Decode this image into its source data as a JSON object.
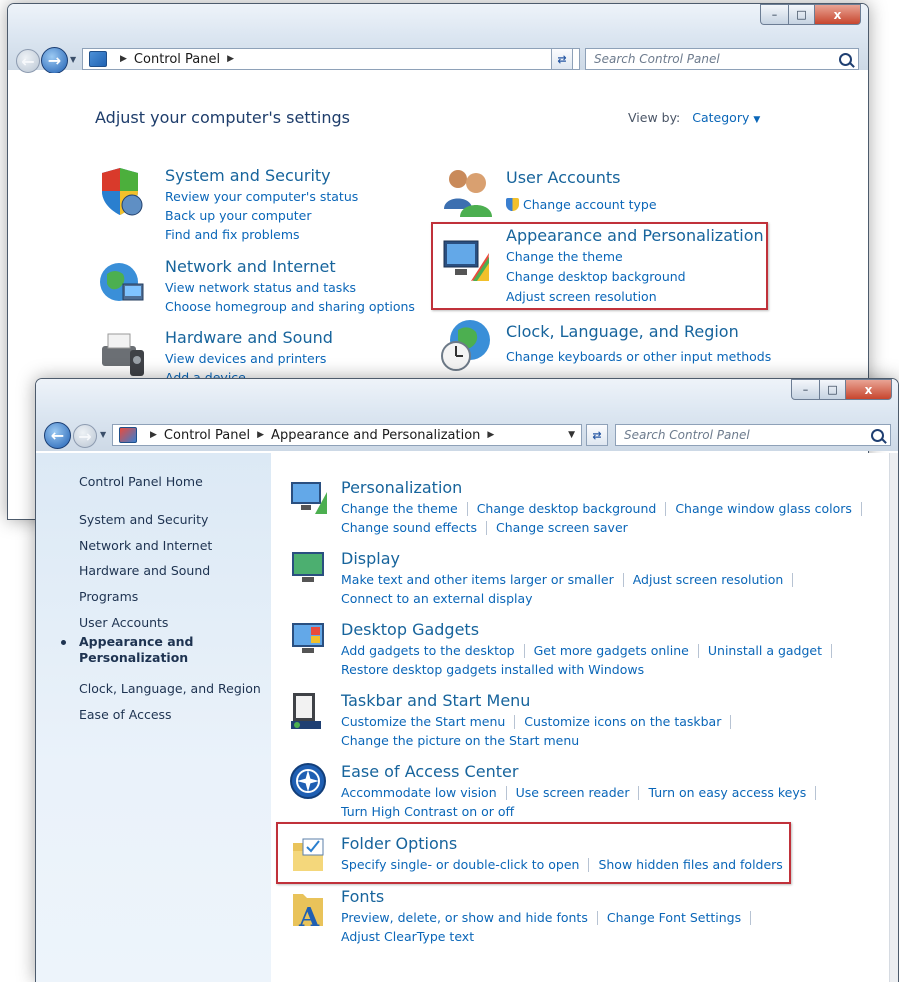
{
  "back_window": {
    "breadcrumb": [
      "Control Panel"
    ],
    "search_placeholder": "Search Control Panel",
    "heading": "Adjust your computer's settings",
    "view_by_label": "View by:",
    "view_by_value": "Category",
    "categories": [
      {
        "title": "System and Security",
        "links": [
          "Review your computer's status",
          "Back up your computer",
          "Find and fix problems"
        ]
      },
      {
        "title": "Network and Internet",
        "links": [
          "View network status and tasks",
          "Choose homegroup and sharing options"
        ]
      },
      {
        "title": "Hardware and Sound",
        "links": [
          "View devices and printers",
          "Add a device"
        ]
      },
      {
        "title": "User Accounts",
        "links": [
          "Change account type"
        ]
      },
      {
        "title": "Appearance and Personalization",
        "links": [
          "Change the theme",
          "Change desktop background",
          "Adjust screen resolution"
        ]
      },
      {
        "title": "Clock, Language, and Region",
        "links": [
          "Change keyboards or other input methods"
        ]
      }
    ]
  },
  "front_window": {
    "breadcrumb": [
      "Control Panel",
      "Appearance and Personalization"
    ],
    "search_placeholder": "Search Control Panel",
    "sidebar": {
      "home": "Control Panel Home",
      "items": [
        {
          "label": "System and Security"
        },
        {
          "label": "Network and Internet"
        },
        {
          "label": "Hardware and Sound"
        },
        {
          "label": "Programs"
        },
        {
          "label": "User Accounts"
        },
        {
          "label": "Appearance and Personalization",
          "active": true
        },
        {
          "label": "Clock, Language, and Region"
        },
        {
          "label": "Ease of Access"
        }
      ]
    },
    "tasks": [
      {
        "title": "Personalization",
        "rows": [
          [
            "Change the theme",
            "Change desktop background",
            "Change window glass colors"
          ],
          [
            "Change sound effects",
            "Change screen saver"
          ]
        ]
      },
      {
        "title": "Display",
        "rows": [
          [
            "Make text and other items larger or smaller",
            "Adjust screen resolution"
          ],
          [
            "Connect to an external display"
          ]
        ]
      },
      {
        "title": "Desktop Gadgets",
        "rows": [
          [
            "Add gadgets to the desktop",
            "Get more gadgets online",
            "Uninstall a gadget"
          ],
          [
            "Restore desktop gadgets installed with Windows"
          ]
        ]
      },
      {
        "title": "Taskbar and Start Menu",
        "rows": [
          [
            "Customize the Start menu",
            "Customize icons on the taskbar"
          ],
          [
            "Change the picture on the Start menu"
          ]
        ]
      },
      {
        "title": "Ease of Access Center",
        "rows": [
          [
            "Accommodate low vision",
            "Use screen reader",
            "Turn on easy access keys"
          ],
          [
            "Turn High Contrast on or off"
          ]
        ]
      },
      {
        "title": "Folder Options",
        "rows": [
          [
            "Specify single- or double-click to open",
            "Show hidden files and folders"
          ]
        ]
      },
      {
        "title": "Fonts",
        "rows": [
          [
            "Preview, delete, or show and hide fonts",
            "Change Font Settings"
          ],
          [
            "Adjust ClearType text"
          ]
        ]
      }
    ]
  },
  "colors": {
    "highlight_box": "#c0313a",
    "link": "#0a66b8",
    "heading": "#17649c"
  }
}
